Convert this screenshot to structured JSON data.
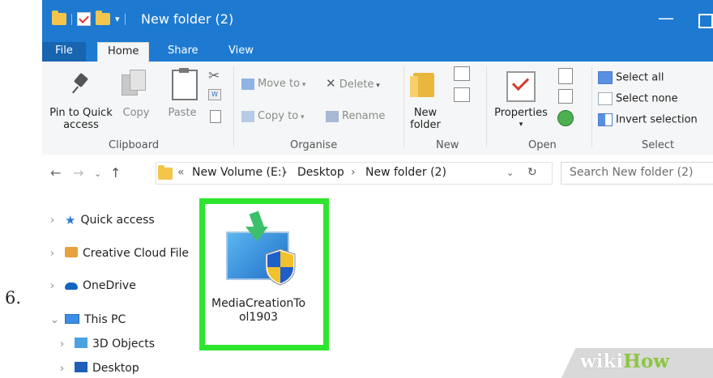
{
  "step_number": "6.",
  "window": {
    "title": "New folder (2)",
    "minimize_glyph": "—"
  },
  "tabs": [
    {
      "label": "File"
    },
    {
      "label": "Home"
    },
    {
      "label": "Share"
    },
    {
      "label": "View"
    }
  ],
  "ribbon": {
    "clipboard": {
      "pin_label_line1": "Pin to Quick",
      "pin_label_line2": "access",
      "copy": "Copy",
      "paste": "Paste",
      "group": "Clipboard"
    },
    "organise": {
      "move_to": "Move to",
      "copy_to": "Copy to",
      "delete": "Delete",
      "rename": "Rename",
      "group": "Organise"
    },
    "new": {
      "new_folder_line1": "New",
      "new_folder_line2": "folder",
      "group": "New"
    },
    "open": {
      "properties": "Properties",
      "group": "Open"
    },
    "select": {
      "select_all": "Select all",
      "select_none": "Select none",
      "invert_selection": "Invert selection",
      "group": "Select"
    }
  },
  "address": {
    "chevron": "«",
    "crumbs": [
      "New Volume (E:)",
      "Desktop",
      "New folder (2)"
    ],
    "separator": "›",
    "search_placeholder": "Search New folder (2)"
  },
  "nav_pane": {
    "items": [
      {
        "label": "Quick access",
        "icon": "star-icon"
      },
      {
        "label": "Creative Cloud File",
        "icon": "creative-cloud-icon"
      },
      {
        "label": "OneDrive",
        "icon": "cloud-icon"
      },
      {
        "label": "This PC",
        "icon": "computer-icon"
      },
      {
        "label": "3D Objects",
        "icon": "cube-icon"
      },
      {
        "label": "Desktop",
        "icon": "desktop-icon"
      }
    ]
  },
  "file": {
    "name_line1": "MediaCreationTo",
    "name_line2": "ol1903",
    "highlight_color": "#2ee52e"
  },
  "watermark": {
    "part1": "wiki",
    "part2": "How"
  },
  "colors": {
    "titlebar": "#1e7ad0",
    "ribbon_bg": "#f5f6f7"
  }
}
